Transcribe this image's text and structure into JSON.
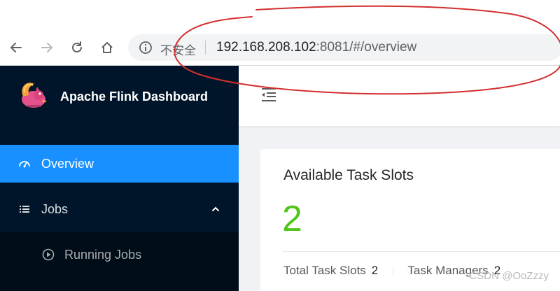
{
  "browser": {
    "security_label": "不安全",
    "url_host": "192.168.208.102",
    "url_rest": ":8081/#/overview"
  },
  "sidebar": {
    "brand": "Apache Flink Dashboard",
    "items": [
      {
        "label": "Overview",
        "icon": "dashboard-icon",
        "active": true
      },
      {
        "label": "Jobs",
        "icon": "list-icon",
        "expanded": true
      },
      {
        "label": "Running Jobs",
        "icon": "play-circle-icon"
      }
    ]
  },
  "main": {
    "card": {
      "title": "Available Task Slots",
      "value": "2",
      "total_slots_label": "Total Task Slots",
      "total_slots_value": "2",
      "task_managers_label": "Task Managers",
      "task_managers_value": "2"
    }
  },
  "watermark": "CSDN @OoZzzy",
  "colors": {
    "sidebar_bg": "#001529",
    "active_item": "#1890ff",
    "value_green": "#52c41a",
    "annotation_red": "#d32f2f"
  }
}
